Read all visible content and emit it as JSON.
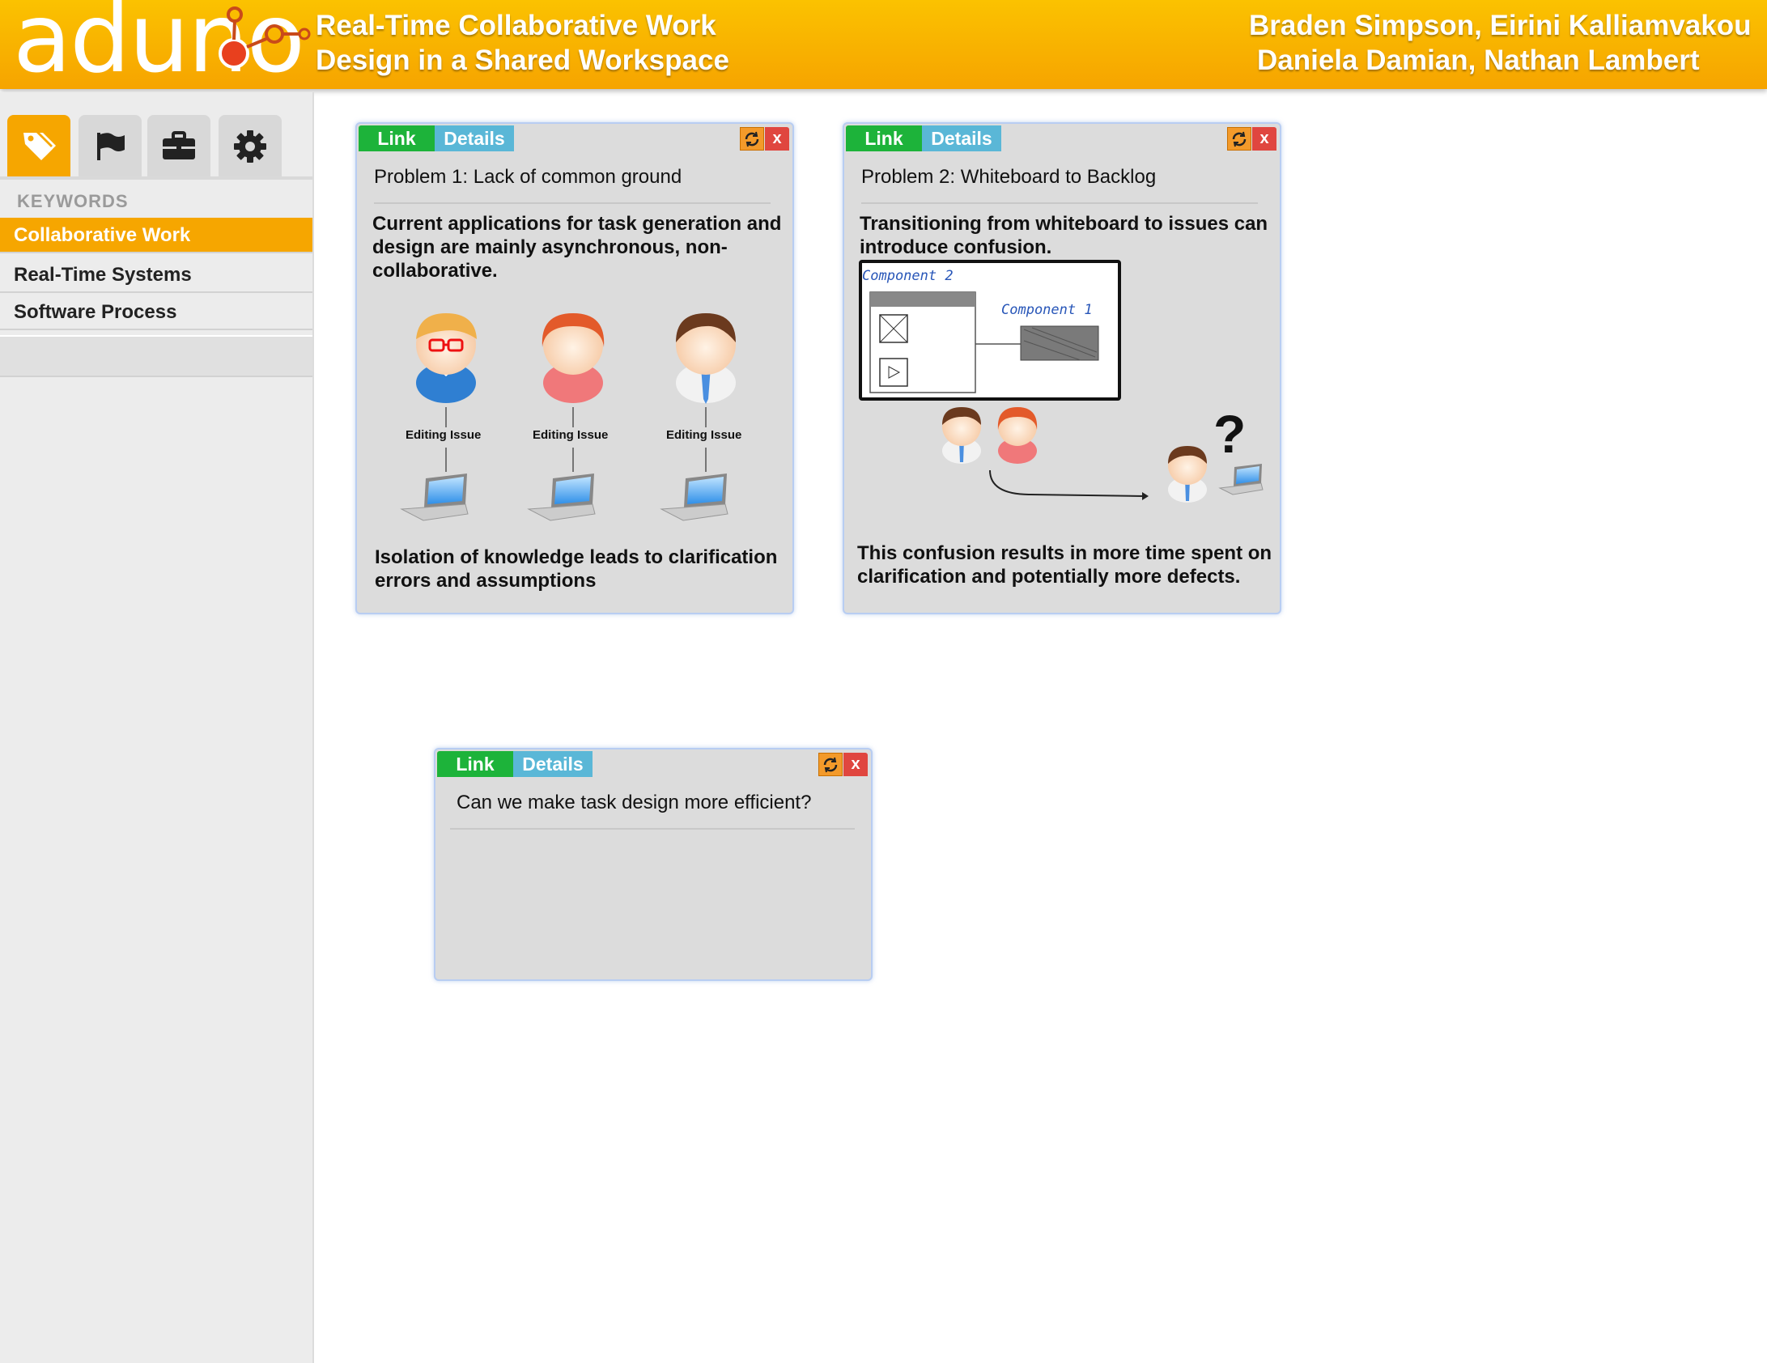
{
  "header": {
    "logo_text": "aduno",
    "title_line1": "Real-Time Collaborative Work",
    "title_line2": "Design in a Shared Workspace",
    "authors_line1": "Braden Simpson, Eirini Kalliamvakou",
    "authors_line2": "Daniela Damian, Nathan Lambert"
  },
  "sidebar": {
    "tabs": [
      {
        "icon": "tag-icon",
        "active": true
      },
      {
        "icon": "flag-icon",
        "active": false
      },
      {
        "icon": "briefcase-icon",
        "active": false
      },
      {
        "icon": "gear-icon",
        "active": false
      }
    ],
    "heading": "KEYWORDS",
    "items": [
      {
        "label": "Collaborative Work",
        "active": true
      },
      {
        "label": "Real-Time Systems",
        "active": false
      },
      {
        "label": "Software Process",
        "active": false
      }
    ]
  },
  "cards": [
    {
      "link_label": "Link",
      "details_label": "Details",
      "close_label": "x",
      "title": "Problem 1: Lack of common ground",
      "text1": "Current applications for task generation and design are mainly asynchronous, non-collaborative.",
      "figure_labels": [
        "Editing Issue",
        "Editing Issue",
        "Editing Issue"
      ],
      "text2": "Isolation of knowledge leads to clarification errors and assumptions"
    },
    {
      "link_label": "Link",
      "details_label": "Details",
      "close_label": "x",
      "title": "Problem 2: Whiteboard to Backlog",
      "text1": "Transitioning from whiteboard to issues can introduce confusion.",
      "whiteboard_labels": [
        "Component 2",
        "Component 1"
      ],
      "question_mark": "?",
      "text2": "This confusion results in more time spent on clarification and potentially more defects."
    },
    {
      "link_label": "Link",
      "details_label": "Details",
      "close_label": "x",
      "title": "Can we make task design more efficient?"
    }
  ],
  "colors": {
    "header_orange": "#f6a400",
    "link_green": "#1db33a",
    "details_blue": "#5ab7d7",
    "refresh_orange": "#f39a2a",
    "close_red": "#e0463f",
    "card_gray": "#dcdcdc"
  }
}
